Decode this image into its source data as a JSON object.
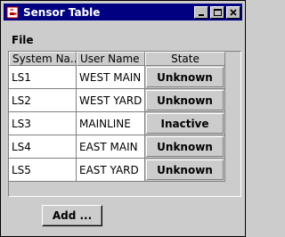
{
  "window": {
    "title": "Sensor Table",
    "icon": "coffee-cup-icon",
    "controls": [
      "minimize-icon",
      "maximize-icon",
      "close-icon"
    ]
  },
  "menubar": {
    "items": [
      {
        "label": "File"
      }
    ]
  },
  "table": {
    "columns": [
      "System Na...",
      "User Name",
      "State"
    ],
    "rows": [
      {
        "system_name": "LS1",
        "user_name": "WEST MAIN",
        "state": "Unknown"
      },
      {
        "system_name": "LS2",
        "user_name": "WEST YARD",
        "state": "Unknown"
      },
      {
        "system_name": "LS3",
        "user_name": "MAINLINE",
        "state": "Inactive"
      },
      {
        "system_name": "LS4",
        "user_name": "EAST MAIN",
        "state": "Unknown"
      },
      {
        "system_name": "LS5",
        "user_name": "EAST YARD",
        "state": "Unknown"
      }
    ]
  },
  "footer": {
    "add_label": "Add ..."
  },
  "colors": {
    "titlebar": "#000080",
    "background": "#cccccc"
  }
}
